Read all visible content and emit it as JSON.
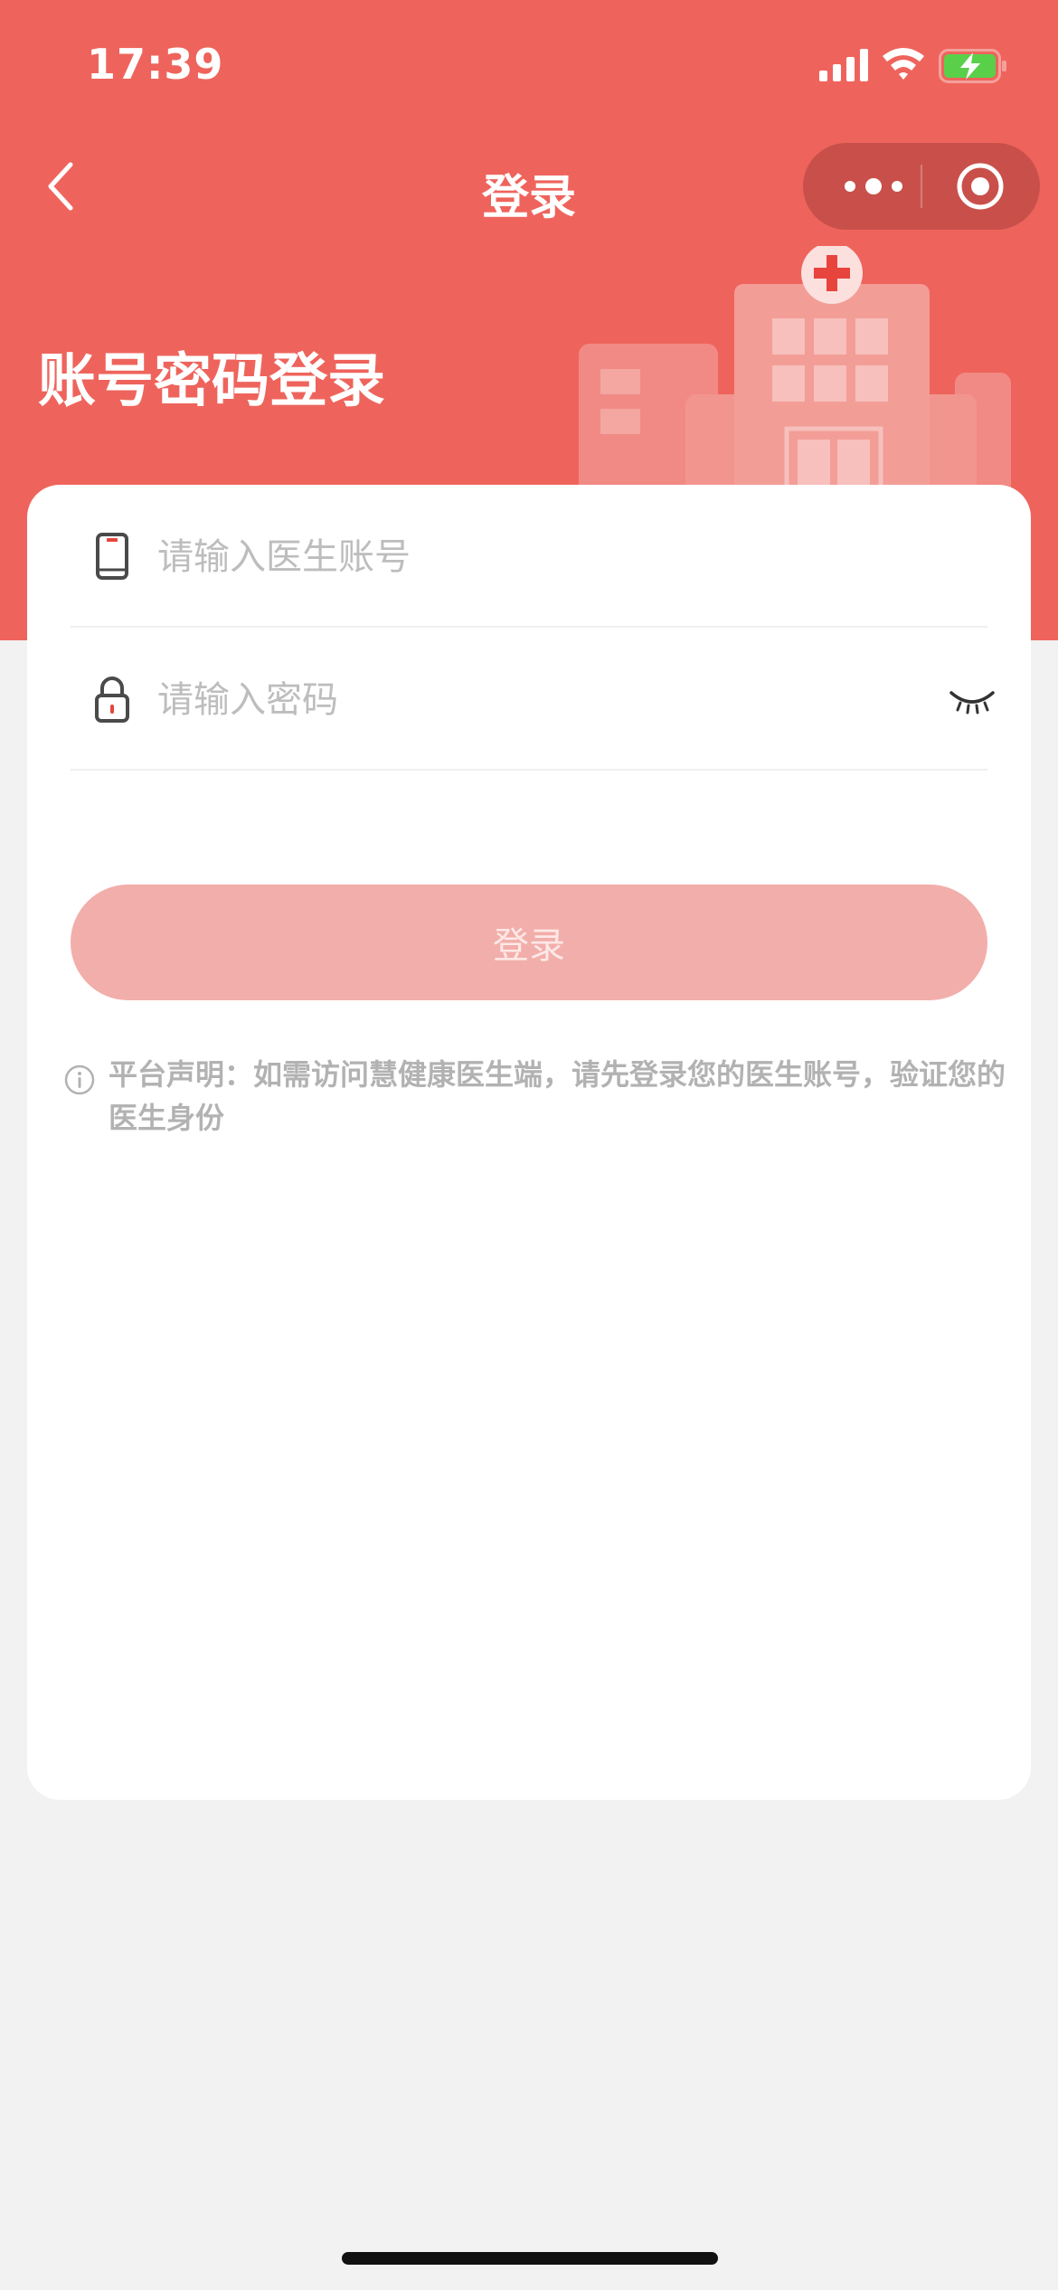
{
  "status_bar": {
    "time": "17:39",
    "icons": [
      "signal-icon",
      "wifi-icon",
      "battery-charging-icon"
    ]
  },
  "nav": {
    "title": "登录",
    "back_icon": "chevron-left-icon",
    "capsule_icons": [
      "more-icon",
      "close-miniprogram-icon"
    ]
  },
  "page": {
    "heading": "账号密码登录"
  },
  "form": {
    "account_placeholder": "请输入医生账号",
    "account_value": "",
    "account_icon": "phone-icon",
    "password_placeholder": "请输入密码",
    "password_value": "",
    "password_icon": "lock-icon",
    "password_toggle_icon": "eye-closed-icon",
    "submit_label": "登录"
  },
  "notice": {
    "icon": "info-icon",
    "text": "平台声明：如需访问慧健康医生端，请先登录您的医生账号，验证您的医生身份"
  },
  "colors": {
    "brand": "#ee645c",
    "button_disabled": "#f2aeaa",
    "page_bg": "#f2f2f2",
    "placeholder": "#bdbdbd"
  }
}
